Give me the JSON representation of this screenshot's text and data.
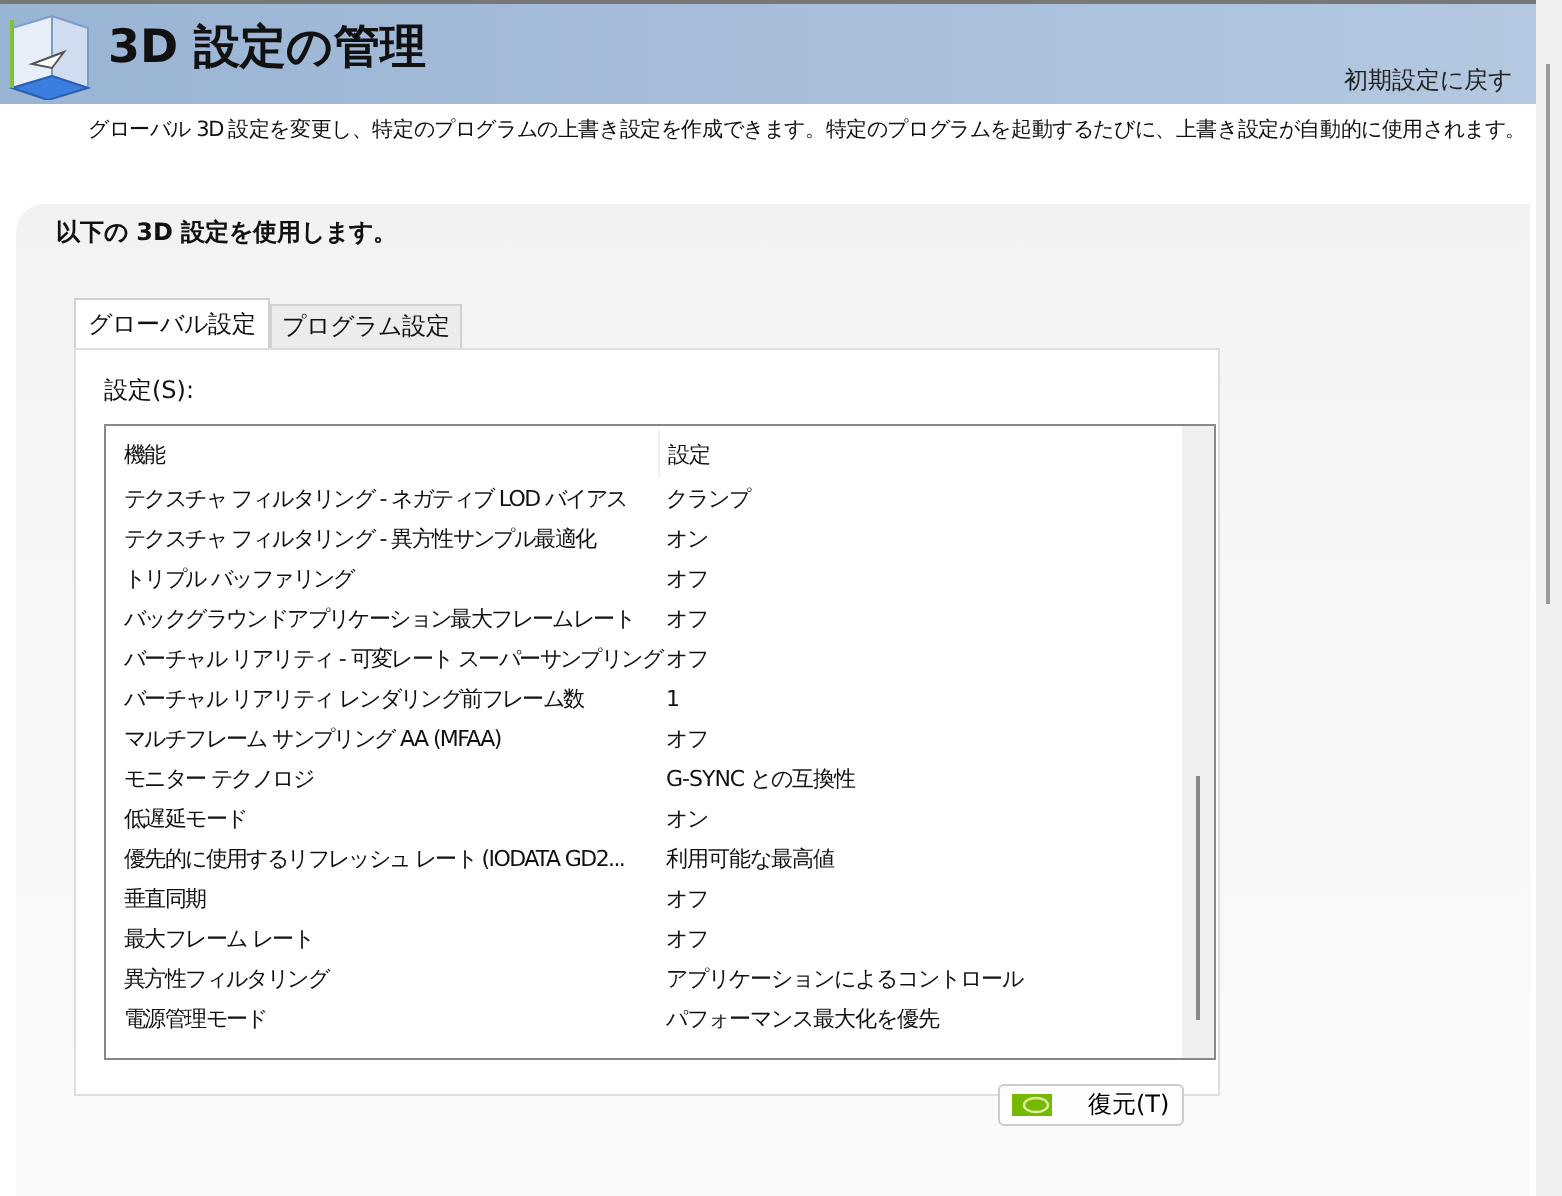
{
  "header": {
    "title": "3D 設定の管理",
    "restore_defaults_link": "初期設定に戻す"
  },
  "description": "グローバル 3D 設定を変更し、特定のプログラムの上書き設定を作成できます。特定のプログラムを起動するたびに、上書き設定が自動的に使用されます。",
  "panel": {
    "heading": "以下の 3D 設定を使用します。",
    "tabs": [
      {
        "label": "グローバル設定",
        "selected": true
      },
      {
        "label": "プログラム設定",
        "selected": false
      }
    ],
    "settings_label": "設定(S):",
    "table": {
      "columns": [
        "機能",
        "設定"
      ],
      "rows": [
        [
          "テクスチャ フィルタリング - ネガティブ LOD バイアス",
          "クランプ"
        ],
        [
          "テクスチャ フィルタリング - 異方性サンプル最適化",
          "オン"
        ],
        [
          "トリプル バッファリング",
          "オフ"
        ],
        [
          "バックグラウンドアプリケーション最大フレームレート",
          "オフ"
        ],
        [
          "バーチャル リアリティ - 可変レート スーパーサンプリング",
          "オフ"
        ],
        [
          "バーチャル リアリティ レンダリング前フレーム数",
          "1"
        ],
        [
          "マルチフレーム サンプリング AA (MFAA)",
          "オフ"
        ],
        [
          "モニター テクノロジ",
          "G-SYNC との互換性"
        ],
        [
          "低遅延モード",
          "オン"
        ],
        [
          "優先的に使用するリフレッシュ レート (IODATA GD2...",
          "利用可能な最高値"
        ],
        [
          "垂直同期",
          "オフ"
        ],
        [
          "最大フレーム レート",
          "オフ"
        ],
        [
          "異方性フィルタリング",
          "アプリケーションによるコントロール"
        ],
        [
          "電源管理モード",
          "パフォーマンス最大化を優先"
        ]
      ]
    },
    "restore_button": "復元(T)"
  }
}
